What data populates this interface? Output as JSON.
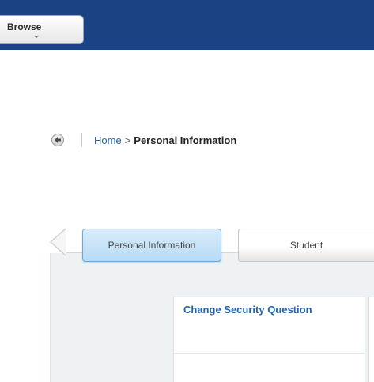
{
  "header": {
    "browse_label": "Browse",
    "background_color": "#1b4384"
  },
  "breadcrumb": {
    "home": "Home",
    "separator": ">",
    "current": "Personal Information"
  },
  "tabs": [
    {
      "label": "Personal Information",
      "selected": true
    },
    {
      "label": "Student",
      "selected": false
    }
  ],
  "cards": [
    {
      "title": "Change Security Question"
    }
  ],
  "colors": {
    "link": "#1e62b0",
    "selected_tab": "#b8dbf4"
  }
}
